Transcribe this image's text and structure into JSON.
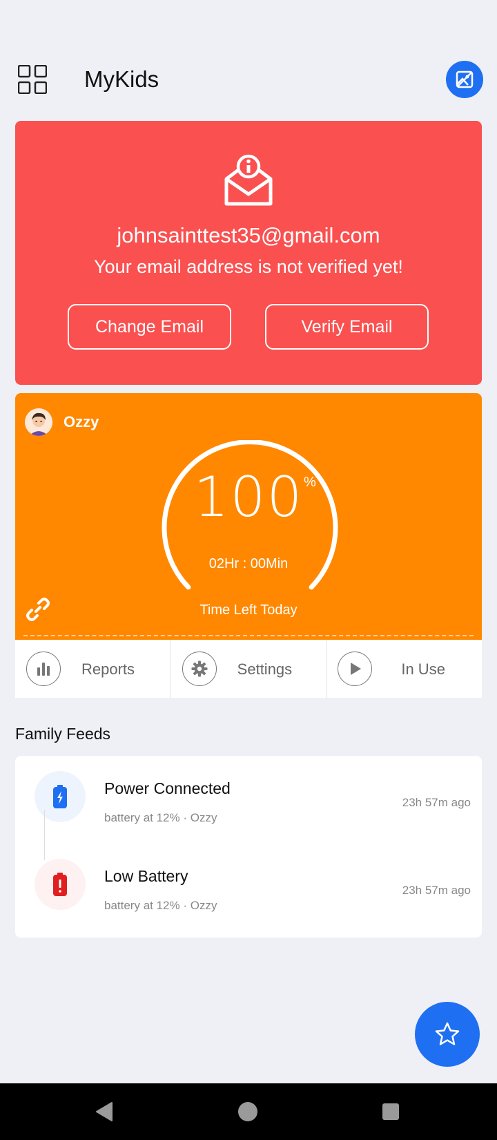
{
  "header": {
    "title": "MyKids",
    "menu_icon": "grid-icon",
    "action_icon": "gallery-icon"
  },
  "verify_banner": {
    "icon": "mail-info-icon",
    "email": "johnsainttest35@gmail.com",
    "message": "Your email address is not verified yet!",
    "change_label": "Change Email",
    "verify_label": "Verify Email",
    "color": "#fa5050"
  },
  "kid": {
    "name": "Ozzy",
    "percent": "100",
    "percent_unit": "%",
    "time_left": "02Hr : 00Min",
    "time_label": "Time Left Today",
    "color": "#ff8800",
    "progress_fraction": 1.0
  },
  "actions": [
    {
      "label": "Reports",
      "icon": "bar-chart-icon"
    },
    {
      "label": "Settings",
      "icon": "gear-icon"
    },
    {
      "label": "In Use",
      "icon": "play-icon"
    }
  ],
  "feeds": {
    "title": "Family Feeds",
    "items": [
      {
        "title": "Power Connected",
        "subtitle": "battery at  12% · Ozzy",
        "time": "23h 57m ago",
        "icon": "battery-charging-icon",
        "color": "#1e6ff1"
      },
      {
        "title": "Low Battery",
        "subtitle": "battery at  12% · Ozzy",
        "time": "23h 57m ago",
        "icon": "battery-alert-icon",
        "color": "#e02020"
      }
    ]
  },
  "fab_icon": "star-icon",
  "accent": "#1e6ff1"
}
